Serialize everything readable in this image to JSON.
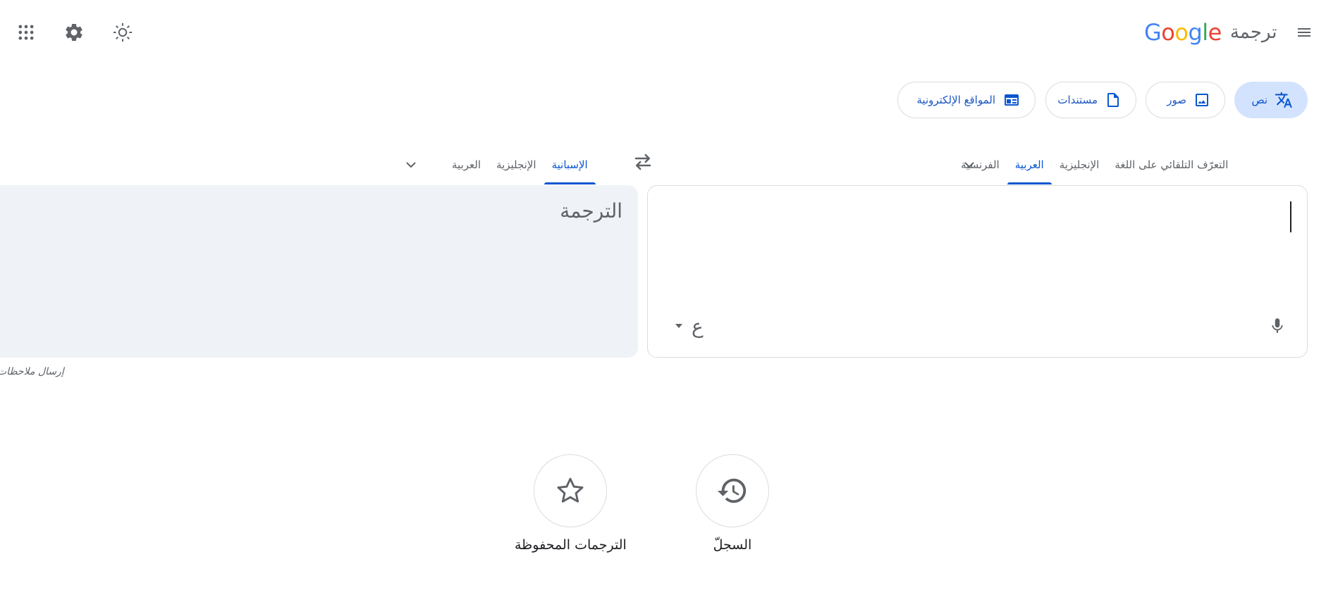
{
  "header": {
    "brand_text": "ترجمة",
    "logo_text": "Google",
    "icons": {
      "menu": "menu-icon",
      "apps": "apps-grid-icon",
      "settings": "gear-icon",
      "theme": "sun-icon"
    }
  },
  "modes": [
    {
      "label": "نص",
      "icon": "translate-icon",
      "active": true
    },
    {
      "label": "صور",
      "icon": "image-icon"
    },
    {
      "label": "مستندات",
      "icon": "document-icon"
    },
    {
      "label": "المواقع الإلكترونية",
      "icon": "website-icon"
    }
  ],
  "source_langs": [
    {
      "label": "التعرّف التلقائي على اللغة"
    },
    {
      "label": "الإنجليزية"
    },
    {
      "label": "العربية",
      "active": true
    },
    {
      "label": "الفرنسية"
    }
  ],
  "target_langs": [
    {
      "label": "الإسبانية",
      "active": true
    },
    {
      "label": "الإنجليزية"
    },
    {
      "label": "العربية"
    }
  ],
  "source": {
    "value": "",
    "ime_char": "ع"
  },
  "target": {
    "placeholder": "الترجمة"
  },
  "feedback_label": "إرسال ملاحظات",
  "bottom": {
    "history_label": "السجلّ",
    "saved_label": "الترجمات المحفوظة"
  },
  "colors": {
    "accent": "#0b57d0",
    "chip_active_bg": "#d3e3fd",
    "target_bg": "#eff3f8",
    "google_blue": "#4285f4",
    "google_red": "#ea4335",
    "google_yellow": "#fbbc05",
    "google_green": "#34a853"
  }
}
